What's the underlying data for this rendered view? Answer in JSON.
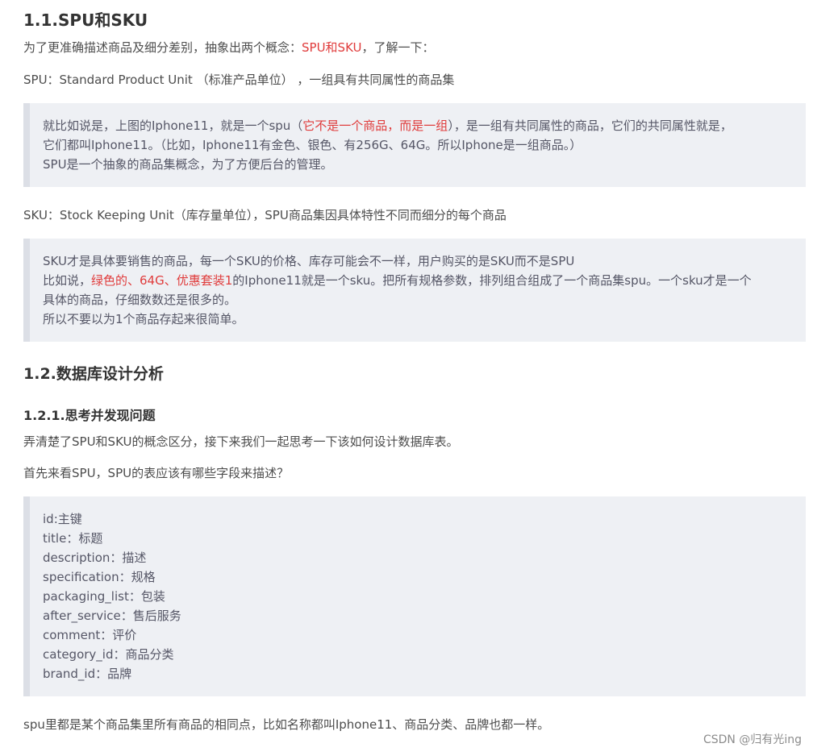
{
  "sec1": {
    "title": "1.1.SPU和SKU",
    "intro_a": "为了更准确描述商品及细分差别，抽象出两个概念：",
    "intro_red": "SPU和SKU",
    "intro_b": "，了解一下：",
    "spu_def": "SPU：Standard Product Unit （标准产品单位） ，一组具有共同属性的商品集",
    "spu_quote": {
      "l1a": "就比如说是，上图的Iphone11，就是一个spu（",
      "l1red": "它不是一个商品，而是一组",
      "l1b": "），是一组有共同属性的商品，它们的共同属性就是，",
      "l2": "它们都叫Iphone11。（比如，Iphone11有金色、银色、有256G、64G。所以Iphone是一组商品。）",
      "l3": "SPU是一个抽象的商品集概念，为了方便后台的管理。"
    },
    "sku_def": "SKU：Stock Keeping Unit（库存量单位），SPU商品集因具体特性不同而细分的每个商品",
    "sku_quote": {
      "l1": "SKU才是具体要销售的商品，每一个SKU的价格、库存可能会不一样，用户购买的是SKU而不是SPU",
      "l2a": "比如说，",
      "l2red": "绿色的、64G、优惠套装1",
      "l2b": "的Iphone11就是一个sku。把所有规格参数，排列组合组成了一个商品集spu。一个sku才是一个",
      "l3": "具体的商品，仔细数数还是很多的。",
      "l4": "所以不要以为1个商品存起来很简单。"
    }
  },
  "sec2": {
    "title": "1.2.数据库设计分析",
    "sub_title": "1.2.1.思考并发现问题",
    "p1": "弄清楚了SPU和SKU的概念区分，接下来我们一起思考一下该如何设计数据库表。",
    "p2": "首先来看SPU，SPU的表应该有哪些字段来描述？",
    "fields": [
      "id:主键",
      "title：标题",
      "description：描述",
      "specification：规格",
      "packaging_list：包装",
      "after_service：售后服务",
      "comment：评价",
      "category_id：商品分类",
      "brand_id：品牌"
    ],
    "p3": "spu里都是某个商品集里所有商品的相同点，比如名称都叫Iphone11、商品分类、品牌也都一样。"
  },
  "watermark": "CSDN @归有光ing",
  "colors": {
    "highlight": "#e03c3c",
    "quote_bg": "#eef0f4",
    "quote_border": "#dcdfe6"
  }
}
